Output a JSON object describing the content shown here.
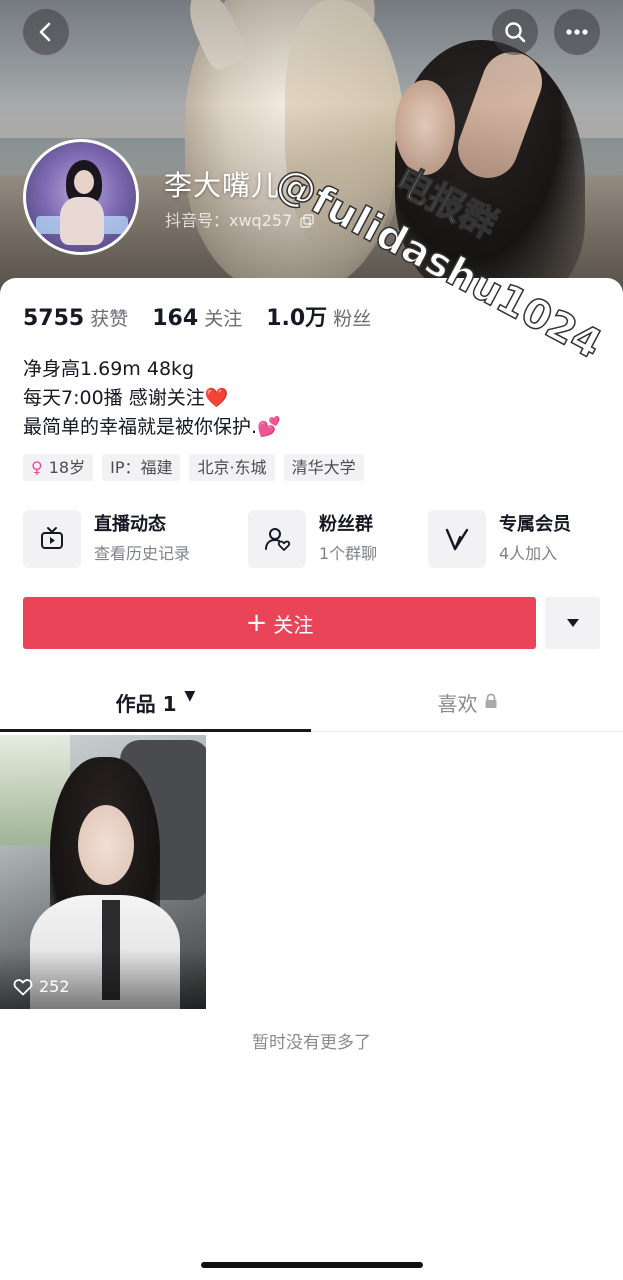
{
  "header": {
    "back_icon": "chevron-left-icon",
    "search_icon": "search-icon",
    "more_icon": "more-horizontal-icon"
  },
  "profile": {
    "nickname": "李大嘴儿",
    "douyin_id": "抖音号：xwq257",
    "copy_icon": "copy-icon"
  },
  "watermark": {
    "line1": "电报群",
    "line2": "@fulidashu1024"
  },
  "stats": [
    {
      "num": "5755",
      "label": "获赞"
    },
    {
      "num": "164",
      "label": "关注"
    },
    {
      "num": "1.0万",
      "label": "粉丝"
    }
  ],
  "bio": {
    "line1": "净身高1.69m  48kg",
    "line2": "每天7:00播 感谢关注",
    "line2_emoji": "❤️",
    "line3": "最简单的幸福就是被你保护.",
    "line3_emoji": "💕"
  },
  "tags": {
    "age": "18岁",
    "age_icon": "female-icon",
    "ip": "IP：福建",
    "location": "北京·东城",
    "school": "清华大学"
  },
  "features": [
    {
      "title": "直播动态",
      "sub": "查看历史记录",
      "icon": "tv-icon"
    },
    {
      "title": "粉丝群",
      "sub": "1个群聊",
      "icon": "fan-group-icon"
    },
    {
      "title": "专属会员",
      "sub": "4人加入",
      "icon": "vip-v-icon"
    }
  ],
  "follow": {
    "label": "关注",
    "plus": "+",
    "color": "#ea4458"
  },
  "tabs": {
    "works": "作品 1",
    "works_caret": "▼",
    "likes": "喜欢",
    "lock_icon": "lock-icon"
  },
  "video": {
    "likes": "252",
    "heart_icon": "heart-outline-icon"
  },
  "footer": {
    "no_more": "暂时没有更多了"
  }
}
